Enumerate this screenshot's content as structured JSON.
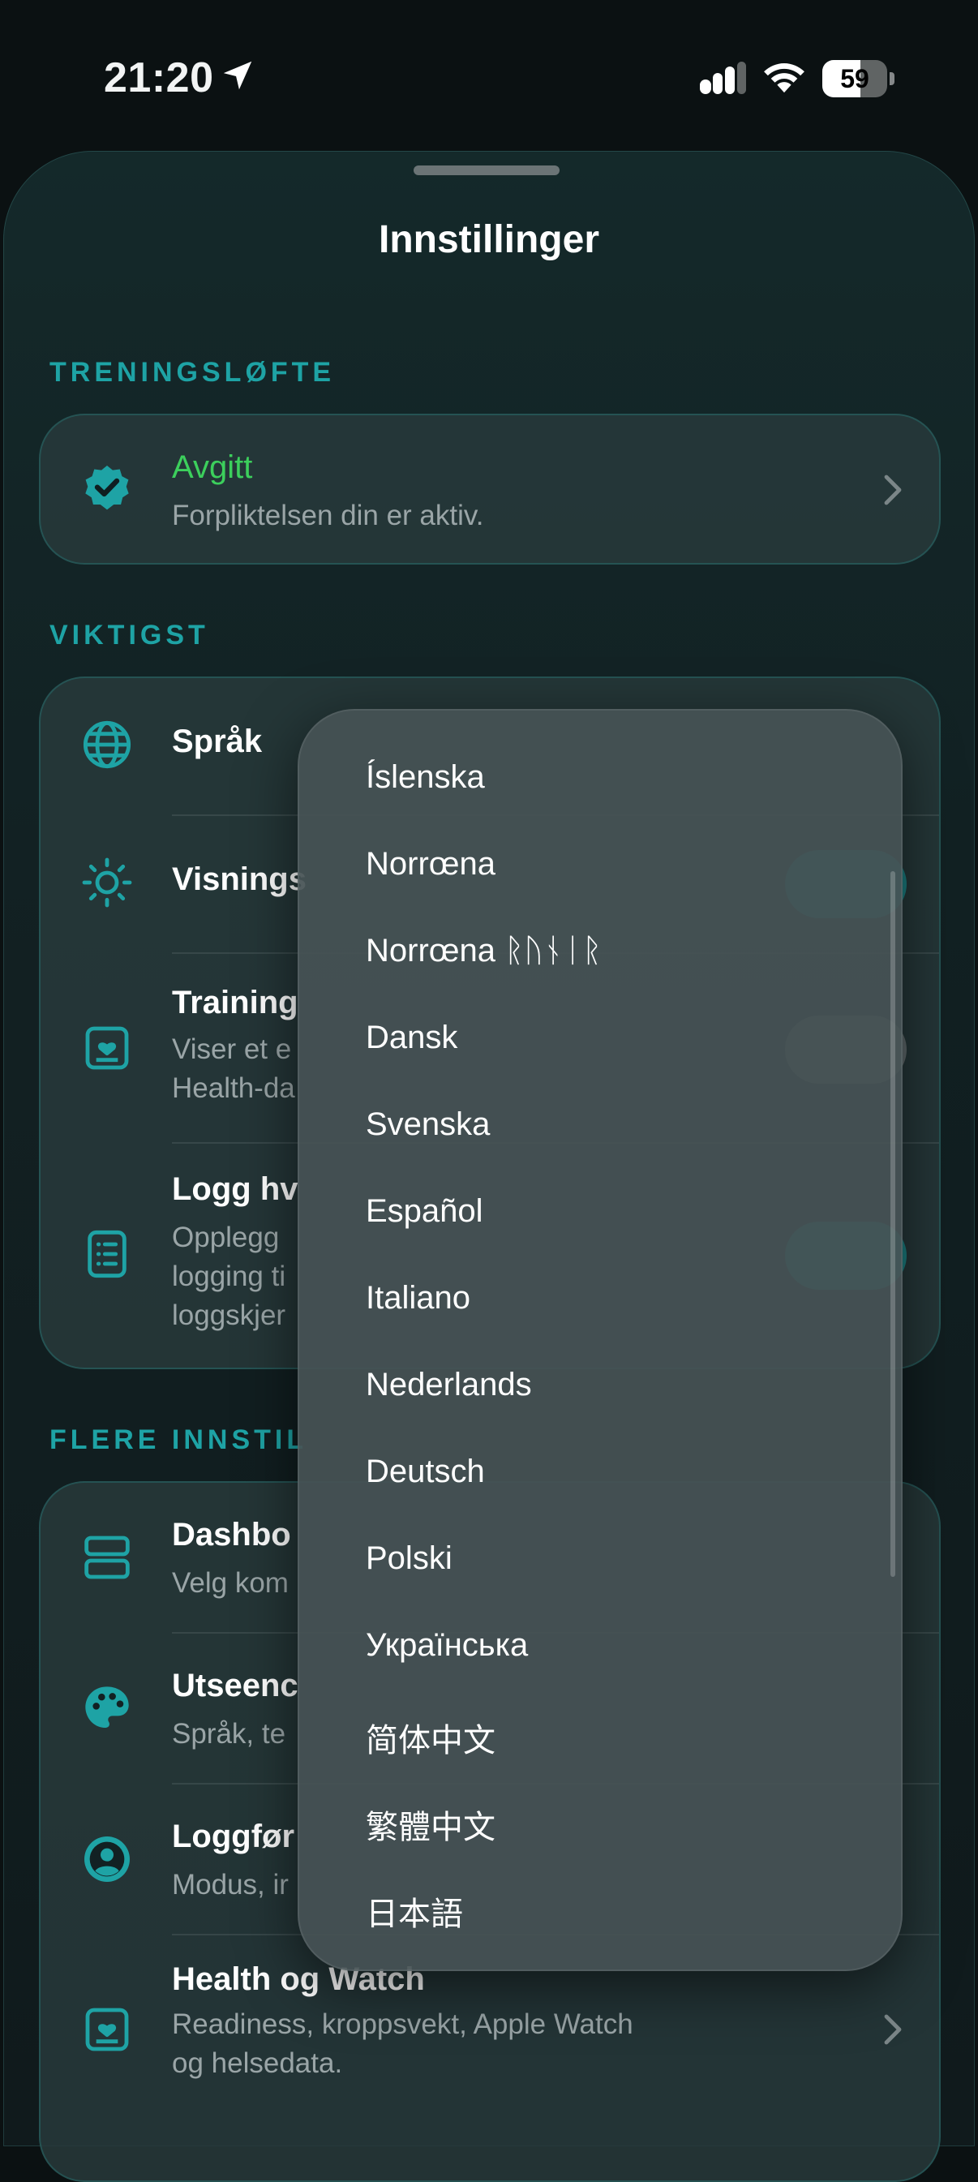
{
  "status_bar": {
    "time": "21:20",
    "battery": "59",
    "battery_level": 0.59
  },
  "sheet": {
    "title": "Innstillinger"
  },
  "sections": {
    "pledge": {
      "header": "TRENINGSLØFTE",
      "title": "Avgitt",
      "subtitle": "Forpliktelsen din er aktiv.",
      "title_color": "#3ccf5c"
    },
    "important": {
      "header": "VIKTIGST",
      "rows": [
        {
          "title": "Språk"
        },
        {
          "title": "Visnings"
        },
        {
          "title": "Training",
          "subtitle": "Viser et e\nHealth-da"
        },
        {
          "title": "Logg hv",
          "subtitle": "Opplegg\nlogging ti\nloggskjer"
        }
      ]
    },
    "more": {
      "header": "FLERE INNSTIL",
      "rows": [
        {
          "title": "Dashbo",
          "subtitle": "Velg kom"
        },
        {
          "title": "Utseenc",
          "subtitle": "Språk, te"
        },
        {
          "title": "Loggfør",
          "subtitle": "Modus, ir"
        },
        {
          "title": "Health og Watch",
          "subtitle": "Readiness, kroppsvekt, Apple Watch\nog helsedata."
        }
      ]
    }
  },
  "language_menu": {
    "items": [
      "Íslenska",
      "Norrœna",
      "Norrœna ᚱᚢᚾᛁᚱ",
      "Dansk",
      "Svenska",
      "Español",
      "Italiano",
      "Nederlands",
      "Deutsch",
      "Polski",
      "Українська",
      "简体中文",
      "繁體中文",
      "日本語"
    ]
  },
  "colors": {
    "accent": "#1ea3a5",
    "pledge_green": "#3ccf5c"
  }
}
